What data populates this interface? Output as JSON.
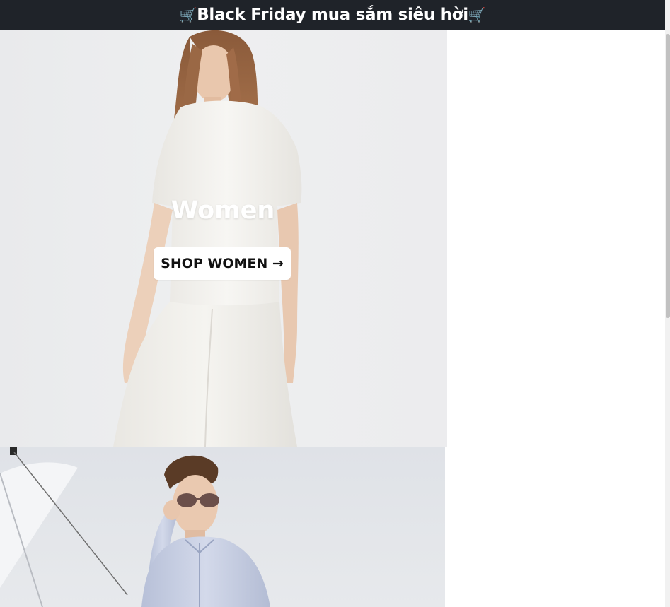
{
  "banner": {
    "cart_left": "🛒",
    "text": "Black Friday mua sắm siêu hời",
    "cart_right": "🛒"
  },
  "women": {
    "title": "Women",
    "button_label": "SHOP WOMEN →"
  },
  "colors": {
    "banner_bg": "#1f2329",
    "banner_text": "#ffffff",
    "button_bg": "#ffffff",
    "button_text": "#111111"
  }
}
